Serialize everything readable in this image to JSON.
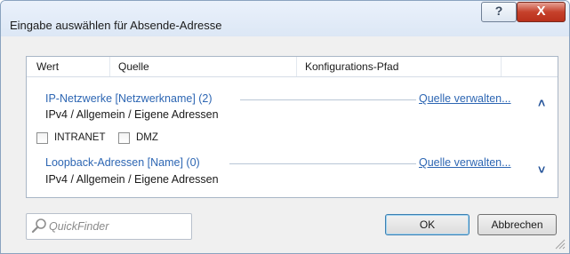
{
  "window": {
    "title": "Eingabe auswählen für Absende-Adresse",
    "help_label": "?",
    "close_label": "X"
  },
  "table": {
    "columns": [
      "Wert",
      "Quelle",
      "Konfigurations-Pfad"
    ]
  },
  "groups": [
    {
      "title": "IP-Netzwerke [Netzwerkname] (2)",
      "link": "Quelle verwalten...",
      "path": "IPv4 / Allgemein / Eigene Adressen",
      "chevron": "˄",
      "expanded": true,
      "items": [
        {
          "label": "INTRANET",
          "checked": false
        },
        {
          "label": "DMZ",
          "checked": false
        }
      ]
    },
    {
      "title": "Loopback-Adressen [Name] (0)",
      "link": "Quelle verwalten...",
      "path": "IPv4 / Allgemein / Eigene Adressen",
      "chevron": "˅",
      "expanded": false,
      "items": []
    }
  ],
  "search": {
    "placeholder": "QuickFinder",
    "value": ""
  },
  "buttons": {
    "ok": "OK",
    "cancel": "Abbrechen"
  },
  "colors": {
    "link": "#2d66b3",
    "titlebar": "#dce7f5",
    "close": "#c6412b",
    "chevron": "#1f4f97"
  },
  "icons": {
    "search": "magnifier-icon",
    "help": "help-icon",
    "close": "close-icon",
    "collapse": "chevron-up-icon",
    "expand": "chevron-down-icon",
    "resize": "resize-grip-icon"
  }
}
